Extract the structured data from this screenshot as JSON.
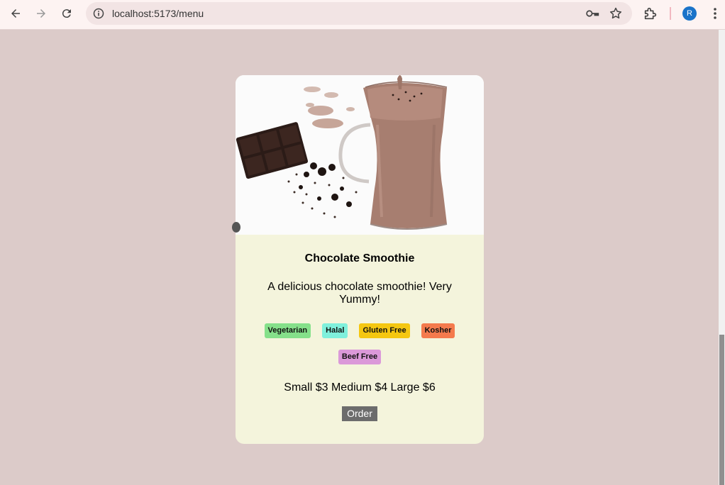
{
  "browser": {
    "url": "localhost:5173/menu",
    "profile_initial": "R",
    "accent_color": "#1a73c9"
  },
  "page": {
    "background": "#dccbc9"
  },
  "card": {
    "image_alt": "Chocolate smoothie in a glass with chocolate pieces",
    "title": "Chocolate Smoothie",
    "description": "A delicious chocolate smoothie! Very Yummy!",
    "tags": [
      {
        "label": "Vegetarian",
        "color": "#85e08a"
      },
      {
        "label": "Halal",
        "color": "#7ff0dc"
      },
      {
        "label": "Gluten Free",
        "color": "#f5c711"
      },
      {
        "label": "Kosher",
        "color": "#f47a4d"
      },
      {
        "label": "Beef Free",
        "color": "#db99d9"
      }
    ],
    "prices": "Small $3 Medium $4 Large $6",
    "order_label": "Order",
    "background": "#f4f4dc"
  }
}
